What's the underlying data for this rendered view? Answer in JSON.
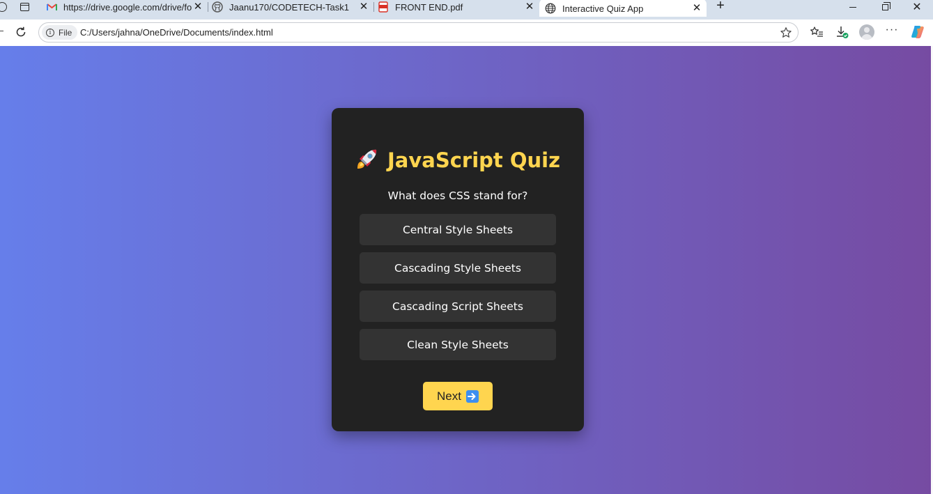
{
  "browser": {
    "tabs": [
      {
        "title": "https://drive.google.com/drive/fo",
        "favicon": "gmail-icon",
        "active": false
      },
      {
        "title": "Jaanu170/CODETECH-Task1",
        "favicon": "github-icon",
        "active": false
      },
      {
        "title": "FRONT END.pdf",
        "favicon": "pdf-icon",
        "active": false
      },
      {
        "title": "Interactive Quiz App",
        "favicon": "globe-icon",
        "active": true
      }
    ],
    "address_bar": {
      "site_chip": "File",
      "url": "C:/Users/jahna/OneDrive/Documents/index.html"
    }
  },
  "quiz": {
    "title": "JavaScript Quiz",
    "title_icon": "rocket-icon",
    "question": "What does CSS stand for?",
    "options": [
      "Central Style Sheets",
      "Cascading Style Sheets",
      "Cascading Script Sheets",
      "Clean Style Sheets"
    ],
    "next_label": "Next",
    "next_icon": "right-arrow-icon"
  },
  "colors": {
    "background_gradient": [
      "#667eea",
      "#764ba2"
    ],
    "card": "#222222",
    "accent": "#ffd54f",
    "option": "#333333"
  }
}
